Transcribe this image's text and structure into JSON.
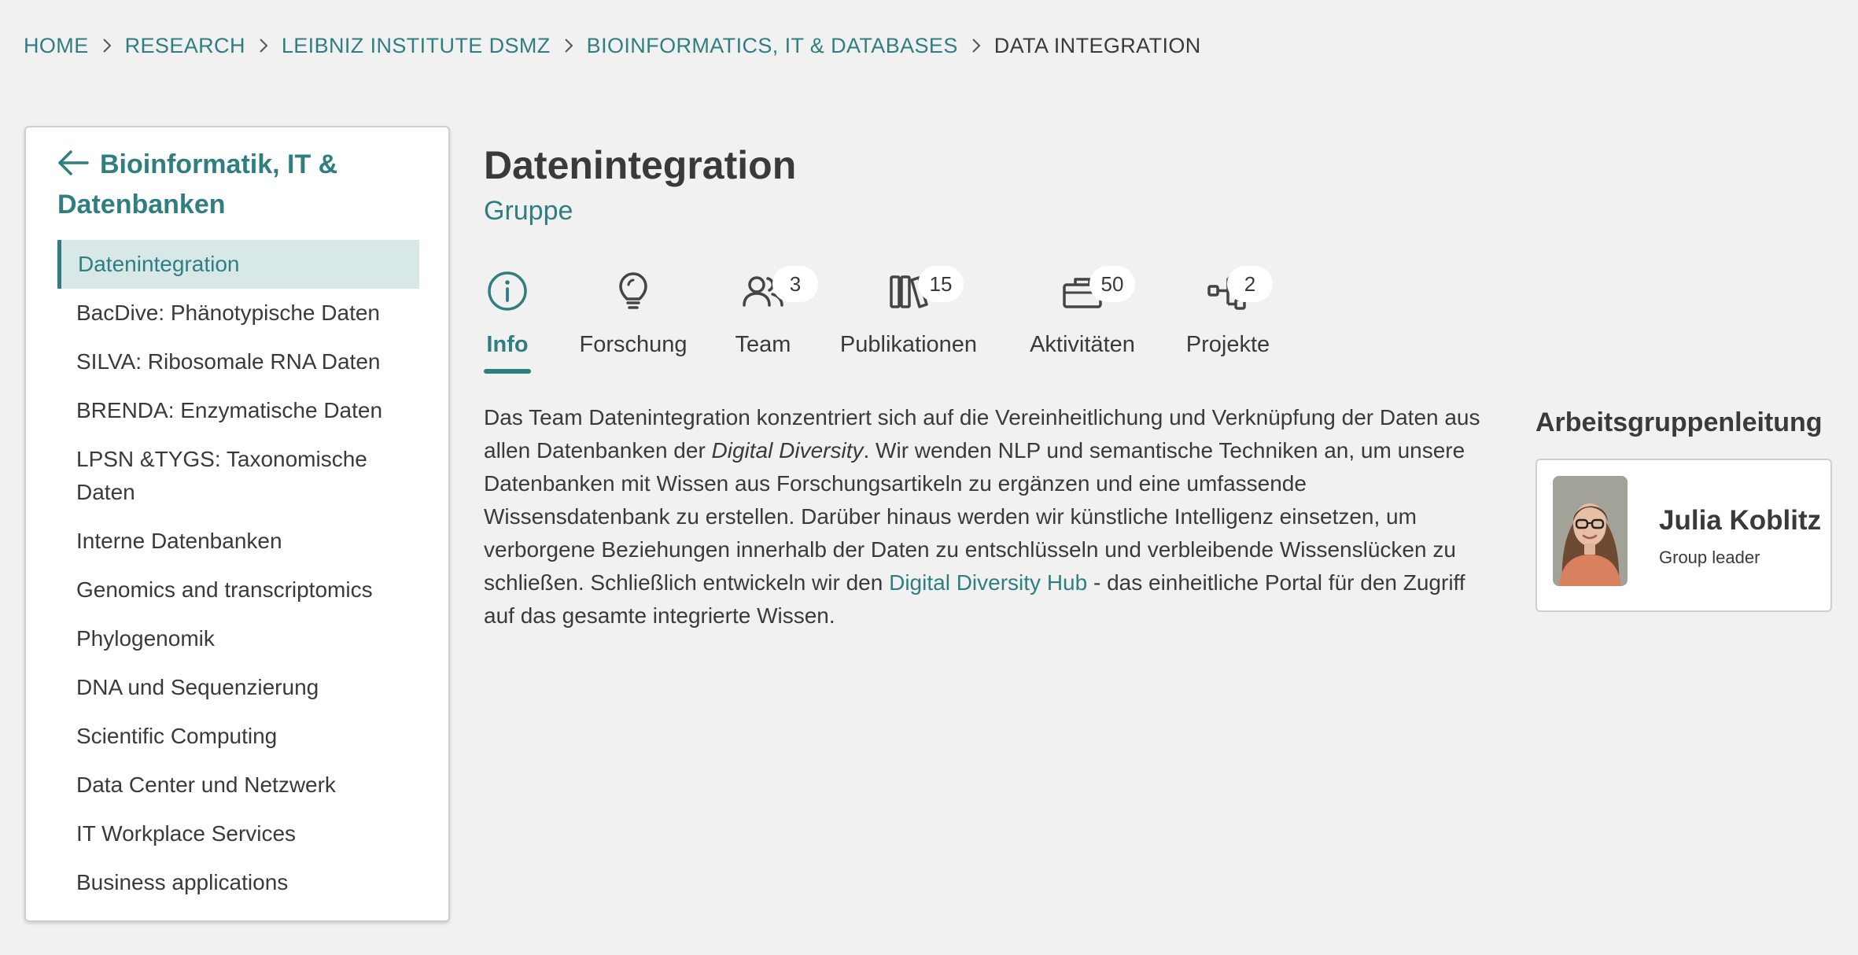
{
  "breadcrumb": [
    {
      "label": "HOME"
    },
    {
      "label": "RESEARCH"
    },
    {
      "label": "LEIBNIZ INSTITUTE DSMZ"
    },
    {
      "label": "BIOINFORMATICS, IT & DATABASES"
    },
    {
      "label": "DATA INTEGRATION"
    }
  ],
  "sidebar": {
    "heading": "Bioinformatik, IT & Datenbanken",
    "items": [
      {
        "label": "Datenintegration"
      },
      {
        "label": "BacDive: Phänotypische Daten"
      },
      {
        "label": "SILVA: Ribosomale RNA Daten"
      },
      {
        "label": "BRENDA: Enzymatische Daten"
      },
      {
        "label": "LPSN &TYGS: Taxonomische Daten"
      },
      {
        "label": "Interne Datenbanken"
      },
      {
        "label": "Genomics and transcriptomics"
      },
      {
        "label": "Phylogenomik"
      },
      {
        "label": "DNA und Sequenzierung"
      },
      {
        "label": "Scientific Computing"
      },
      {
        "label": "Data Center und Netzwerk"
      },
      {
        "label": "IT Workplace Services"
      },
      {
        "label": "Business applications"
      }
    ]
  },
  "page": {
    "title": "Datenintegration",
    "subtitle": "Gruppe"
  },
  "tabs": [
    {
      "label": "Info",
      "icon": "info-icon"
    },
    {
      "label": "Forschung",
      "icon": "lightbulb-icon"
    },
    {
      "label": "Team",
      "icon": "team-icon",
      "count": "3"
    },
    {
      "label": "Publikationen",
      "icon": "books-icon",
      "count": "15"
    },
    {
      "label": "Aktivitäten",
      "icon": "briefcase-icon",
      "count": "50"
    },
    {
      "label": "Projekte",
      "icon": "project-tree-icon",
      "count": "2"
    }
  ],
  "description": {
    "part1": "Das Team Datenintegration konzentriert sich auf die Vereinheitlichung und Verknüpfung der Daten aus allen Datenbanken der ",
    "emphasis": "Digital Diversity",
    "part2": ". Wir wenden NLP und semantische Techniken an, um unsere Datenbanken mit Wissen aus Forschungsartikeln zu ergänzen und eine umfassende Wissensdatenbank zu erstellen. Darüber hinaus werden wir künstliche Intelligenz einsetzen, um verborgene Beziehungen innerhalb der Daten zu entschlüsseln und verbleibende Wissenslücken zu schließen. Schließlich entwickeln wir den ",
    "link": "Digital Diversity Hub",
    "part3": " - das einheitliche Portal für den Zugriff auf das gesamte integrierte Wissen."
  },
  "lead": {
    "heading": "Arbeitsgruppenleitung",
    "name": "Julia Koblitz",
    "role": "Group leader"
  },
  "colors": {
    "accent": "#2f7f80",
    "background": "#f1f1f1",
    "text": "#3a3a3a",
    "active_item_bg": "#d8e8e8"
  }
}
